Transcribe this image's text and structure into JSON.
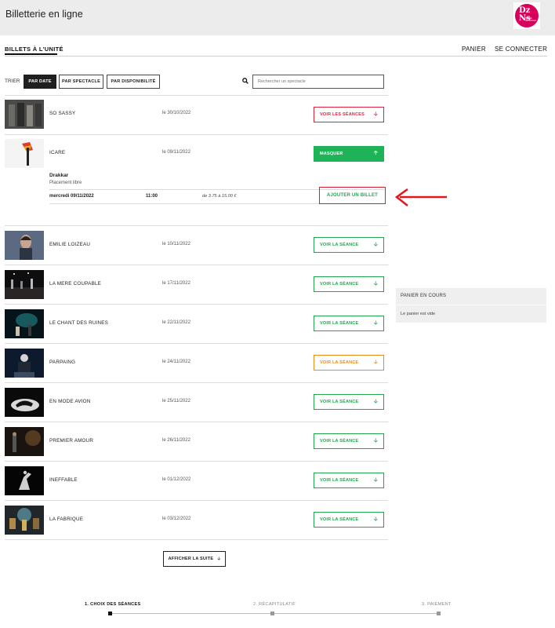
{
  "header": {
    "title": "Billetterie en ligne",
    "logo_text": {
      "l1": "Dz",
      "l2": "Ns",
      "l3": "SCÈNE NATIONALE"
    }
  },
  "nav": {
    "tab": "BILLETS À L'UNITÉ",
    "panier": "PANIER",
    "connect": "SE CONNECTER"
  },
  "sort": {
    "label": "TRIER",
    "options": [
      "PAR DATE",
      "PAR SPECTACLE",
      "PAR DISPONIBILITÉ"
    ],
    "active": "PAR DATE"
  },
  "search": {
    "placeholder": "Rechercher un spectacle"
  },
  "shows": [
    {
      "title": "SO SASSY",
      "date": "le 30/10/2022",
      "button": "VOIR LES SÉANCES",
      "status": "red",
      "arrow": "down"
    },
    {
      "title": "ICARE",
      "date": "le 09/11/2022",
      "button": "MASQUER",
      "status": "filled",
      "arrow": "up"
    },
    {
      "title": "EMILIE LOIZEAU",
      "date": "le 10/11/2022",
      "button": "VOIR LA SÉANCE",
      "status": "green",
      "arrow": "down"
    },
    {
      "title": "LA MERE COUPABLE",
      "date": "le 17/11/2022",
      "button": "VOIR LA SÉANCE",
      "status": "green",
      "arrow": "down"
    },
    {
      "title": "LE CHANT DES RUINES",
      "date": "le 22/11/2022",
      "button": "VOIR LA SÉANCE",
      "status": "green",
      "arrow": "down"
    },
    {
      "title": "PARPAING",
      "date": "le 24/11/2022",
      "button": "VOIR LA SÉANCE",
      "status": "orange",
      "arrow": "down"
    },
    {
      "title": "EN MODE AVION",
      "date": "le 25/11/2022",
      "button": "VOIR LA SÉANCE",
      "status": "green",
      "arrow": "down"
    },
    {
      "title": "PREMIER AMOUR",
      "date": "le 26/11/2022",
      "button": "VOIR LA SÉANCE",
      "status": "green",
      "arrow": "down"
    },
    {
      "title": "INEFFABLE",
      "date": "le 01/12/2022",
      "button": "VOIR LA SÉANCE",
      "status": "green",
      "arrow": "down"
    },
    {
      "title": "LA FABRIQUE",
      "date": "le 03/12/2022",
      "button": "VOIR LA SÉANCE",
      "status": "green",
      "arrow": "down"
    }
  ],
  "session": {
    "venue": "Drakkar",
    "placement": "Placement libre",
    "date": "mercredi 09/11/2022",
    "time": "11:00",
    "price": "de 3.75 à 15.00 €",
    "add_label": "AJOUTER UN BILLET"
  },
  "cart": {
    "title": "PANIER EN COURS",
    "empty": "Le panier est vide"
  },
  "more": {
    "label": "AFFICHER LA SUITE"
  },
  "steps": [
    {
      "label": "1. CHOIX DES SÉANCES",
      "active": true
    },
    {
      "label": "2. RÉCAPITULATIF",
      "active": false
    },
    {
      "label": "3. PAIEMENT",
      "active": false
    }
  ],
  "colors": {
    "red": "#e0253b",
    "green": "#21a64d",
    "orange": "#f08a16",
    "filled": "#1db356",
    "logo": "#d9005b"
  }
}
